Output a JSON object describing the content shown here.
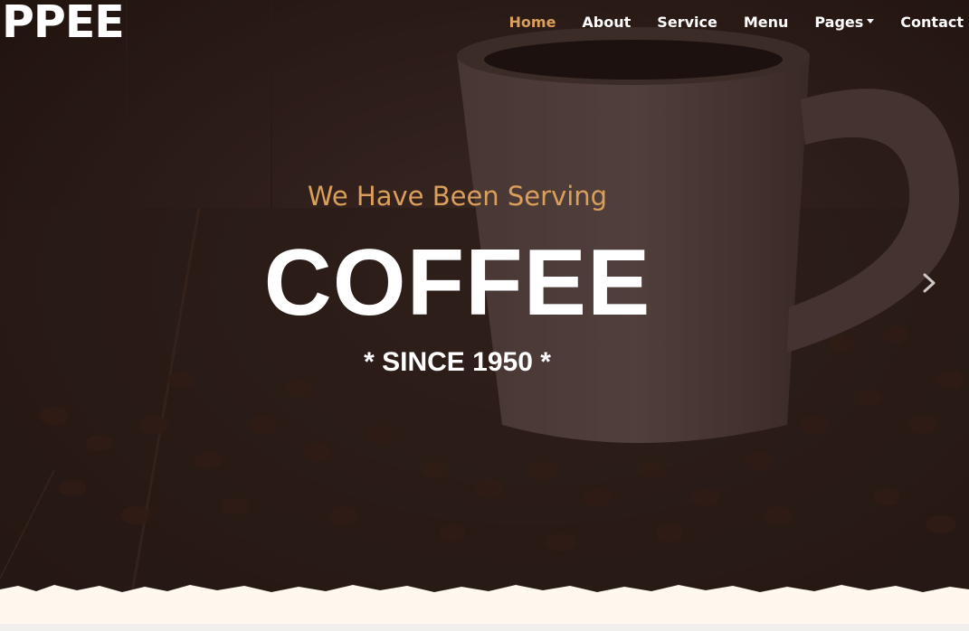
{
  "navbar": {
    "brand": "PPEE",
    "links": [
      {
        "label": "Home",
        "active": true
      },
      {
        "label": "About",
        "active": false
      },
      {
        "label": "Service",
        "active": false
      },
      {
        "label": "Menu",
        "active": false
      },
      {
        "label": "Pages",
        "active": false,
        "dropdown": true
      },
      {
        "label": "Contact",
        "active": false
      }
    ]
  },
  "hero": {
    "subtitle": "We Have Been Serving",
    "title": "COFFEE",
    "since": "* SINCE 1950 *",
    "next_icon": "chevron-right-icon"
  },
  "colors": {
    "accent": "#da9f5b",
    "overlay": "#2a1b17",
    "paper_edge": "#fff8ef"
  }
}
